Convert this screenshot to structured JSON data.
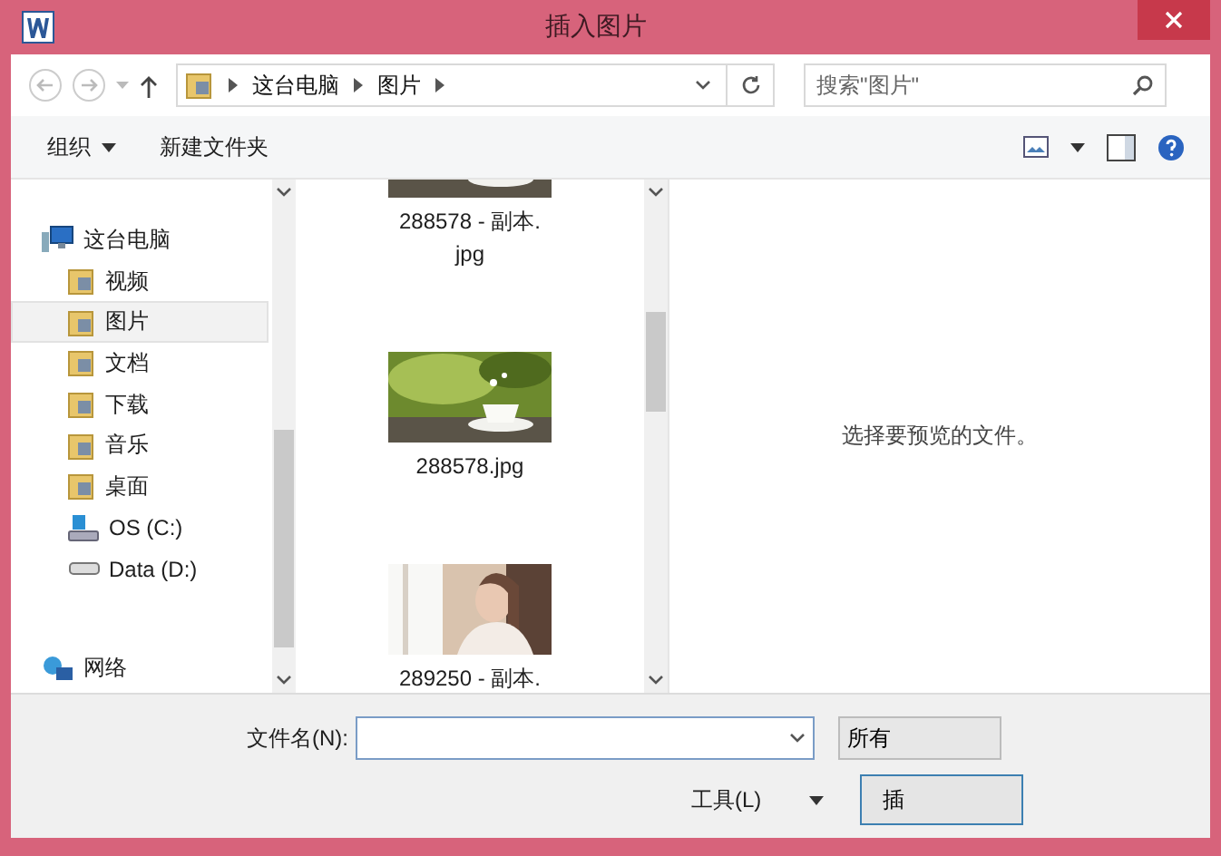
{
  "window": {
    "title": "插入图片"
  },
  "nav": {
    "breadcrumb": [
      "这台电脑",
      "图片"
    ],
    "search": {
      "placeholder": "搜索\"图片\""
    }
  },
  "toolbar": {
    "organize": "组织",
    "new_folder": "新建文件夹"
  },
  "sidebar": {
    "items": [
      {
        "label": "这台电脑",
        "kind": "computer",
        "selected": false,
        "children": [
          {
            "label": "视频",
            "kind": "folder",
            "selected": false
          },
          {
            "label": "图片",
            "kind": "folder",
            "selected": true
          },
          {
            "label": "文档",
            "kind": "folder",
            "selected": false
          },
          {
            "label": "下载",
            "kind": "folder",
            "selected": false
          },
          {
            "label": "音乐",
            "kind": "folder",
            "selected": false
          },
          {
            "label": "桌面",
            "kind": "folder",
            "selected": false
          },
          {
            "label": "OS (C:)",
            "kind": "system-drive",
            "selected": false
          },
          {
            "label": "Data (D:)",
            "kind": "drive",
            "selected": false
          }
        ]
      },
      {
        "label": "网络",
        "kind": "network",
        "selected": false
      }
    ]
  },
  "files": [
    {
      "lines": [
        "288578 - 副本.",
        "jpg"
      ]
    },
    {
      "lines": [
        "288578.jpg"
      ]
    },
    {
      "lines": [
        "289250 - 副本."
      ]
    }
  ],
  "preview": {
    "message": "选择要预览的文件。"
  },
  "footer": {
    "filename_label": "文件名(N):",
    "filetype": "所有",
    "tools": "工具(L)",
    "insert": "插"
  }
}
